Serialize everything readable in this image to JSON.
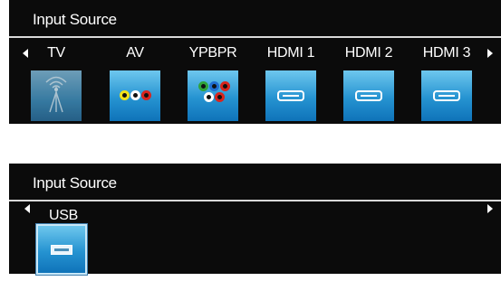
{
  "top_panel": {
    "title": "Input Source",
    "sources": [
      {
        "label": "TV",
        "icon": "antenna-icon"
      },
      {
        "label": "AV",
        "icon": "av-rca-icon"
      },
      {
        "label": "YPBPR",
        "icon": "component-rca-icon"
      },
      {
        "label": "HDMI 1",
        "icon": "hdmi-port-icon"
      },
      {
        "label": "HDMI 2",
        "icon": "hdmi-port-icon"
      },
      {
        "label": "HDMI 3",
        "icon": "hdmi-port-icon"
      }
    ]
  },
  "bottom_panel": {
    "title": "Input Source",
    "sources": [
      {
        "label": "USB",
        "icon": "usb-port-icon"
      }
    ]
  },
  "colors": {
    "panel_bg": "#0b0b0b",
    "tile_gradient_top": "#6ec7ee",
    "tile_gradient_bottom": "#0f73b9",
    "rca_yellow": "#f2e21a",
    "rca_white": "#ffffff",
    "rca_red": "#d9251d",
    "rca_green": "#2fa33a",
    "rca_blue": "#1f6fd1"
  }
}
